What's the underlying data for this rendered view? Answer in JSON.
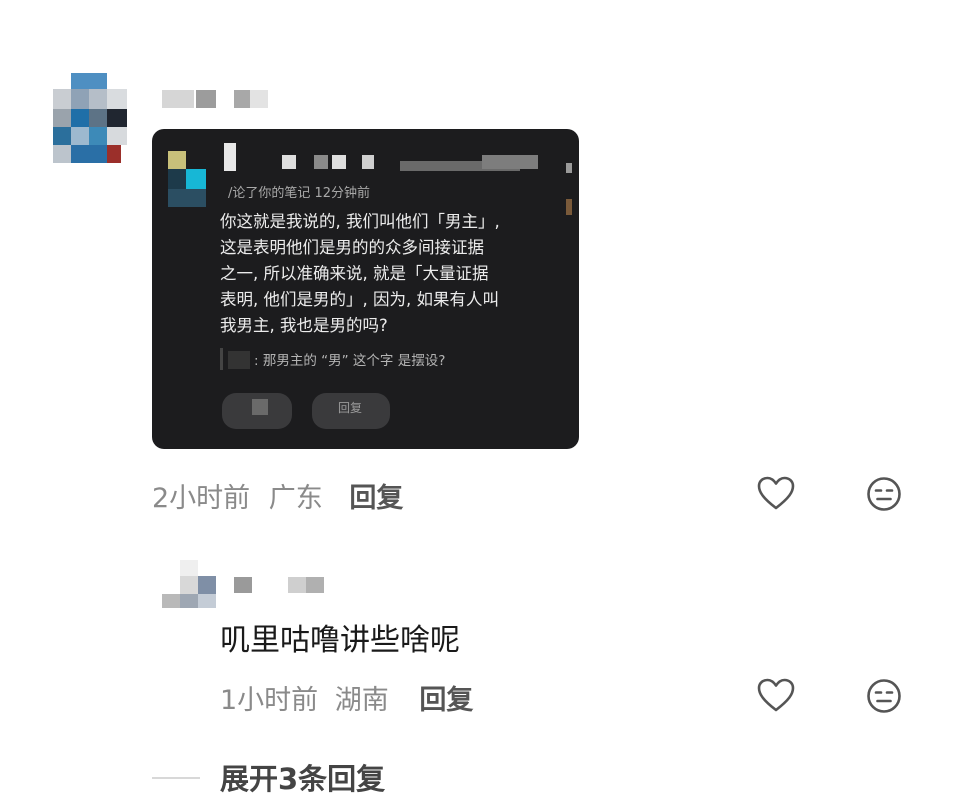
{
  "comment": {
    "card": {
      "meta_text": "/论了你的笔记  12分钟前",
      "body_lines": [
        "你这就是我说的, 我们叫他们「男主」,",
        "这是表明他们是男的的众多间接证据",
        "之一, 所以准确来说, 就是「大量证据",
        "表明, 他们是男的」, 因为, 如果有人叫",
        "我男主, 我也是男的吗?"
      ],
      "quote_text": ": 那男主的 “男” 这个字 是摆设?",
      "reply_label": "回复"
    },
    "time": "2小时前",
    "location": "广东",
    "reply_label": "回复",
    "like_icon": "heart-outline-icon",
    "react_icon": "emoji-face-icon"
  },
  "reply": {
    "text": "叽里咕噜讲些啥呢",
    "time": "1小时前",
    "location": "湖南",
    "reply_label": "回复",
    "like_icon": "heart-outline-icon",
    "react_icon": "emoji-face-icon"
  },
  "expand": {
    "label": "展开3条回复"
  }
}
